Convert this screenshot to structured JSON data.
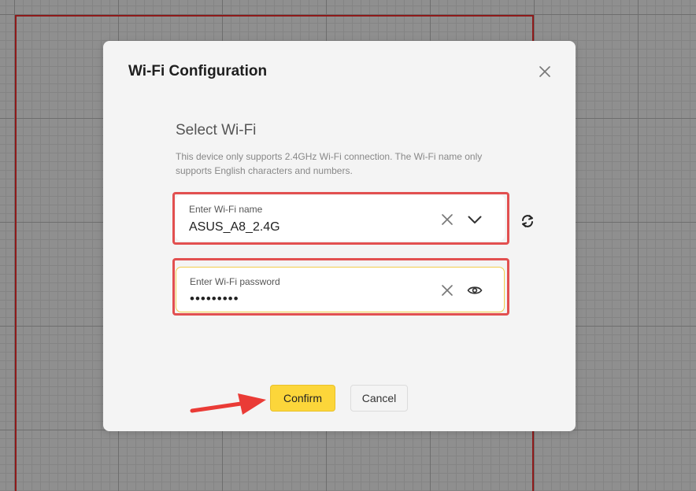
{
  "dialog": {
    "title": "Wi-Fi Configuration",
    "section_title": "Select Wi-Fi",
    "description": "This device only supports 2.4GHz Wi-Fi connection. The Wi-Fi name only supports English characters and numbers."
  },
  "wifi_name": {
    "label": "Enter Wi-Fi name",
    "value": "ASUS_A8_2.4G"
  },
  "wifi_password": {
    "label": "Enter Wi-Fi password",
    "value": "•••••••••"
  },
  "buttons": {
    "confirm": "Confirm",
    "cancel": "Cancel"
  },
  "icons": {
    "close": "close-icon",
    "clear": "clear-icon",
    "dropdown": "chevron-down-icon",
    "refresh": "refresh-icon",
    "show_password": "eye-icon",
    "annotation": "arrow-annotation"
  },
  "colors": {
    "highlight": "#e25050",
    "confirm_button": "#fcd63a",
    "arrow": "#ea3b36"
  }
}
